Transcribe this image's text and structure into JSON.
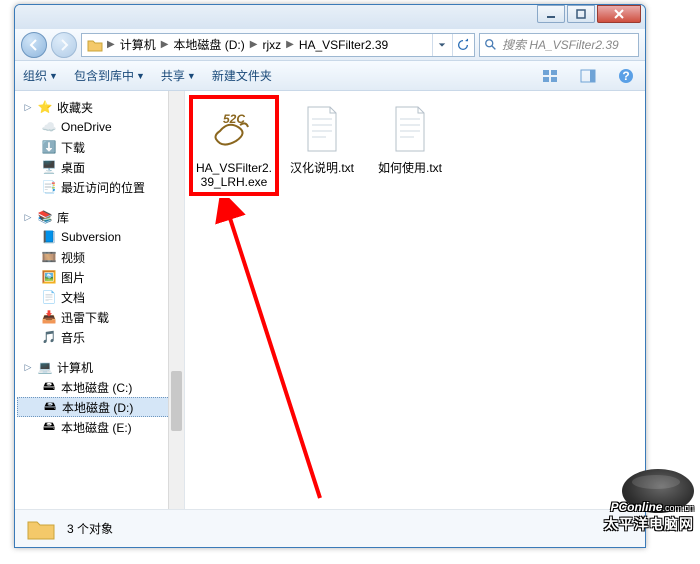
{
  "breadcrumb": {
    "p0": "计算机",
    "p1": "本地磁盘 (D:)",
    "p2": "rjxz",
    "p3": "HA_VSFilter2.39"
  },
  "search": {
    "placeholder": "搜索 HA_VSFilter2.39"
  },
  "toolbar": {
    "organize": "组织",
    "include": "包含到库中",
    "share": "共享",
    "newfolder": "新建文件夹"
  },
  "tree": {
    "favorites": "收藏夹",
    "onedrive": "OneDrive",
    "downloads": "下载",
    "desktop": "桌面",
    "recent": "最近访问的位置",
    "libraries": "库",
    "subversion": "Subversion",
    "videos": "视频",
    "pictures": "图片",
    "documents": "文档",
    "xunlei": "迅雷下载",
    "music": "音乐",
    "computer": "计算机",
    "drive_c": "本地磁盘 (C:)",
    "drive_d": "本地磁盘 (D:)",
    "drive_e": "本地磁盘 (E:)"
  },
  "files": {
    "f1": {
      "name": "HA_VSFilter2.39_LRH.exe",
      "badge": "52C"
    },
    "f2": {
      "name": "汉化说明.txt"
    },
    "f3": {
      "name": "如何使用.txt"
    }
  },
  "status": {
    "count": "3 个对象"
  },
  "watermark": {
    "line1a": "PConline",
    "line1b": ".com.cn",
    "line2": "太平洋电脑网"
  }
}
